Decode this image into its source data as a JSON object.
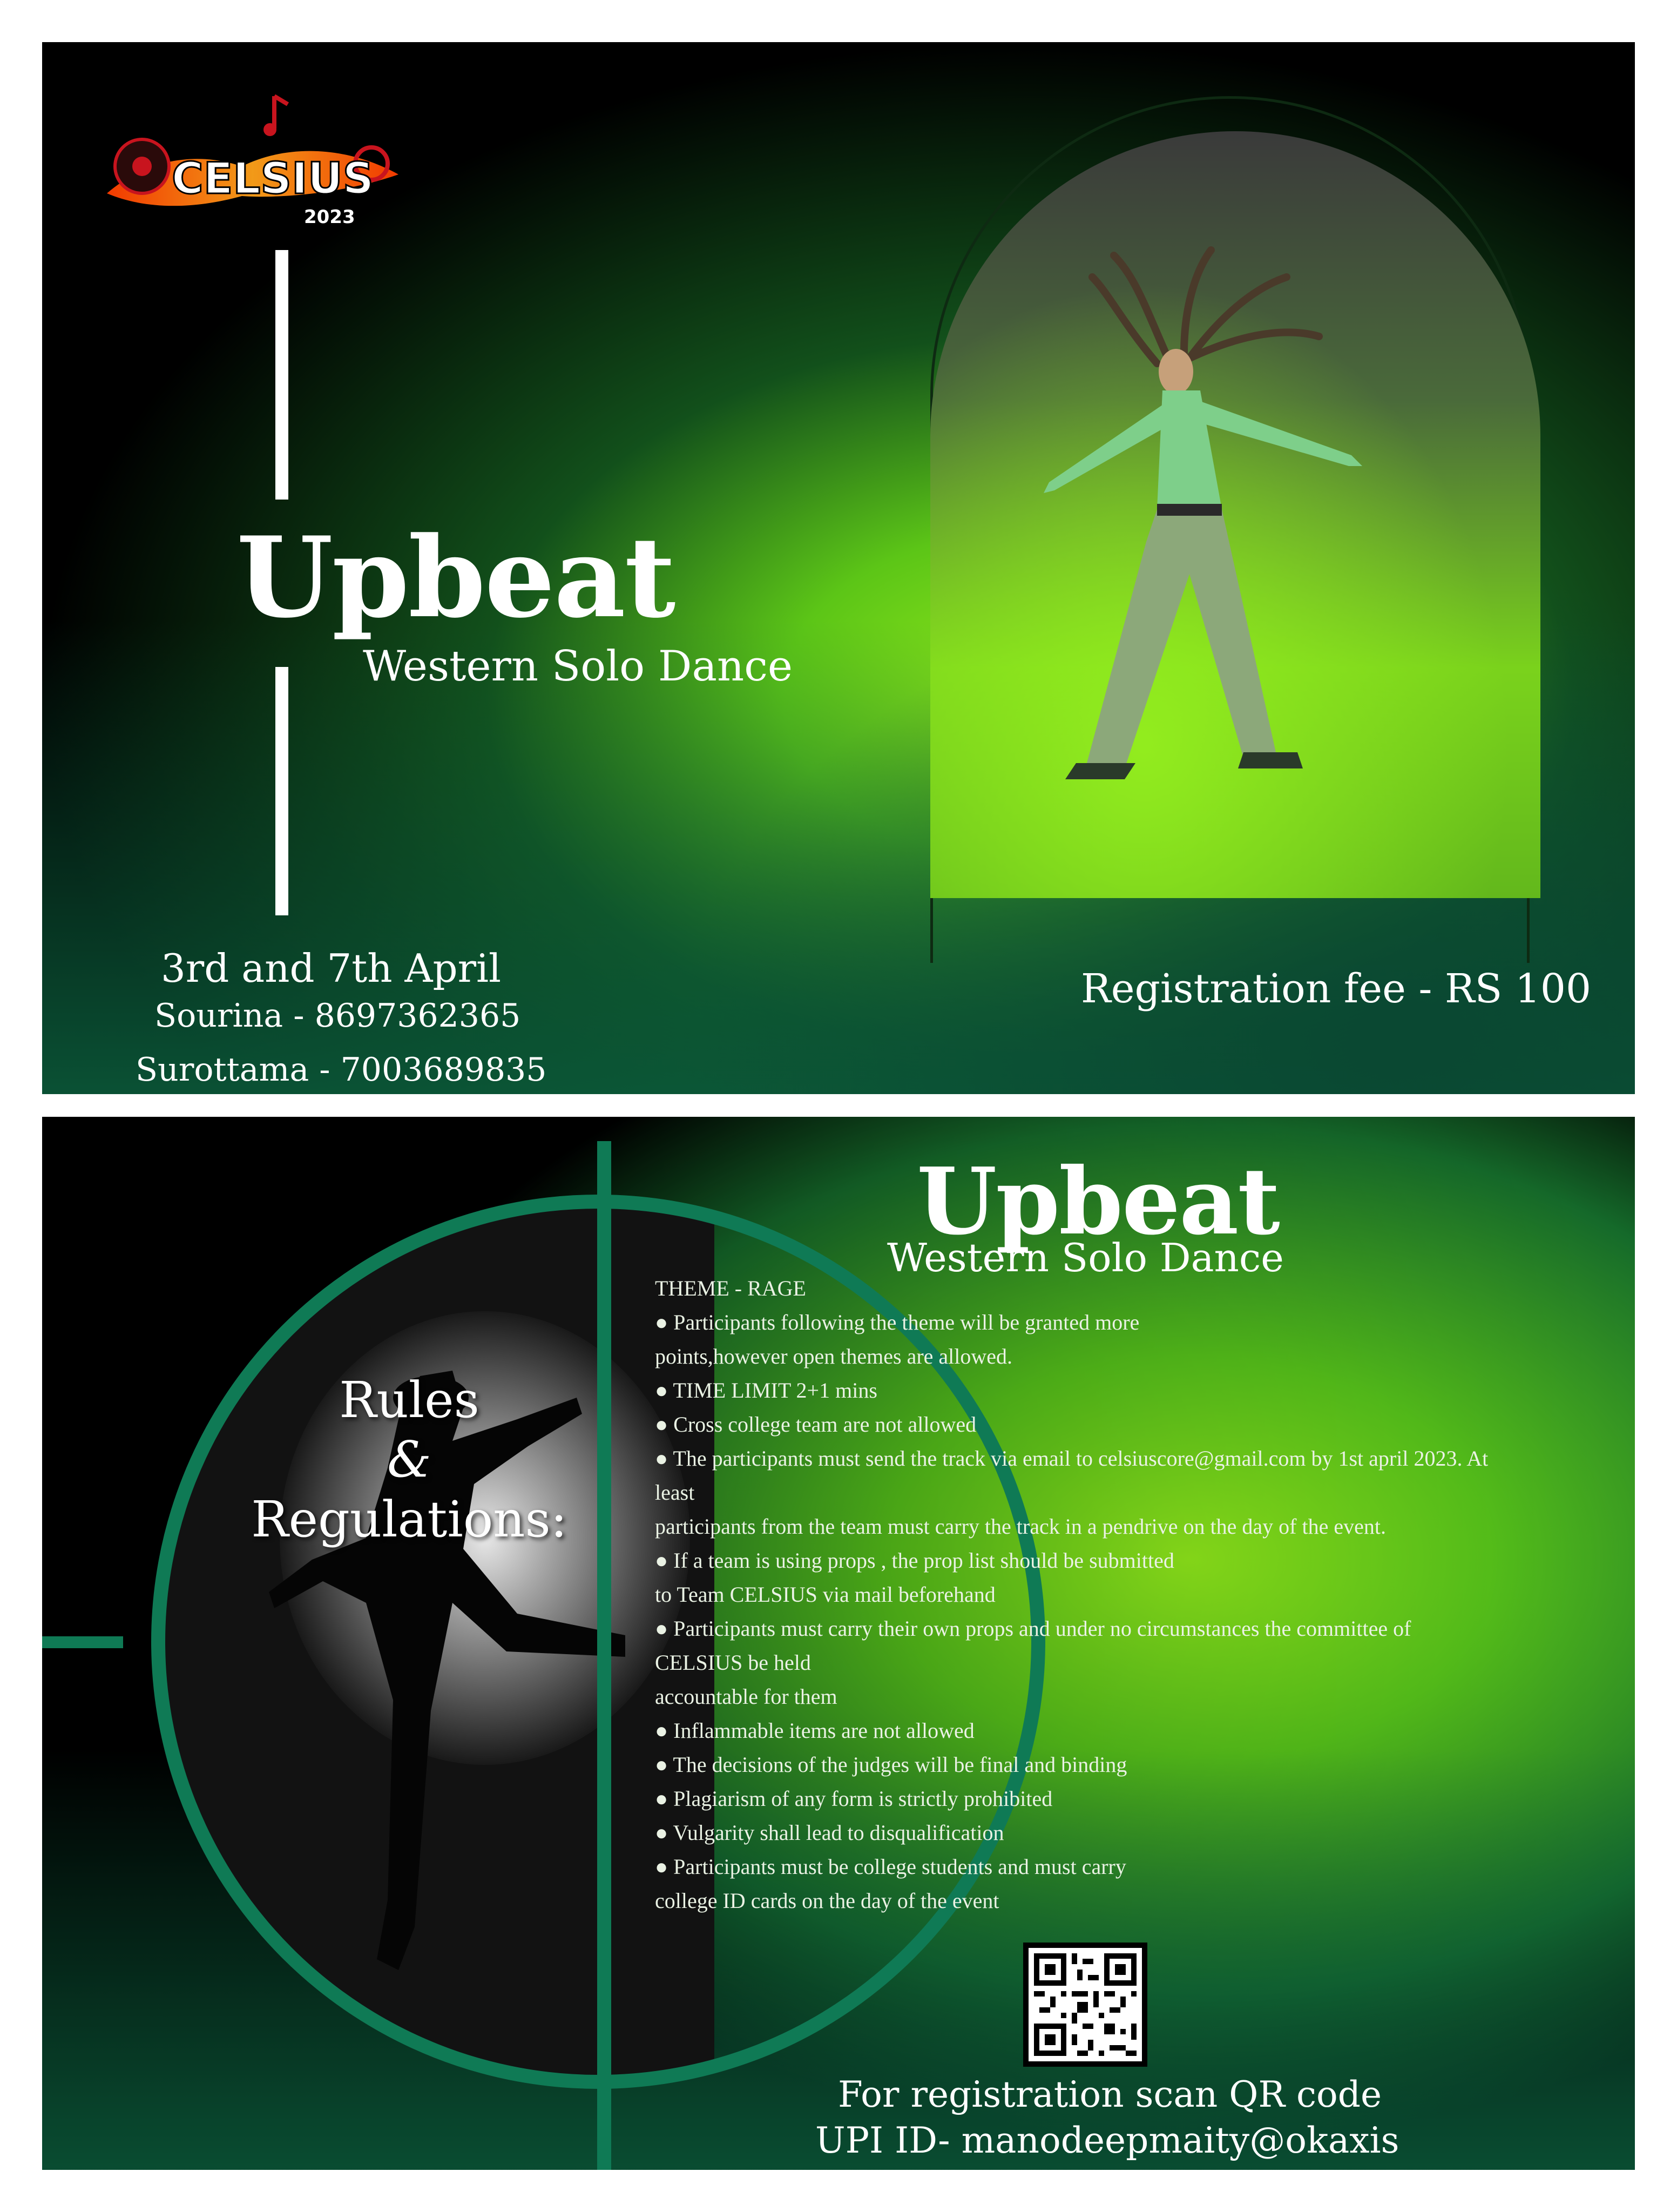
{
  "top": {
    "logo_text": "CELSIUS",
    "logo_year": "2023",
    "title": "Upbeat",
    "subtitle": "Western Solo Dance",
    "date": "3rd and 7th April",
    "contacts": [
      "Sourina - 8697362365",
      "Surottama - 7003689835"
    ],
    "fee": "Registration fee - RS 100"
  },
  "bottom": {
    "title": "Upbeat",
    "subtitle": "Western Solo Dance",
    "rules_heading": [
      "Rules",
      "&",
      "Regulations:"
    ],
    "rules": [
      "THEME - RAGE",
      "● Participants following the theme will be granted more",
      "points,however open themes are allowed.",
      "● TIME LIMIT 2+1 mins",
      "● Cross college team are not allowed",
      "● The participants must send the track via email to celsiuscore@gmail.com by 1st april 2023. At",
      "least",
      "participants from the team must carry the track in a pendrive on the day of the event.",
      "● If a team is using props , the prop list should be submitted",
      "to Team CELSIUS via mail beforehand",
      "● Participants must carry their own props and under no circumstances the committee of",
      "CELSIUS be held",
      "accountable for them",
      "● Inflammable items are not allowed",
      "● The decisions of the judges will be final and binding",
      "● Plagiarism of any form is strictly prohibited",
      "● Vulgarity shall lead to disqualification",
      "● Participants must be college students and must carry",
      "college ID cards on the day of the event"
    ],
    "footer": [
      "For registration scan QR code",
      "UPI ID- manodeepmaity@okaxis"
    ]
  },
  "colors": {
    "accent_green": "#7be21a",
    "dark_green": "#0b5a3a",
    "ring_green": "#0f7a55",
    "logo_fire": "#ff7a1a"
  }
}
